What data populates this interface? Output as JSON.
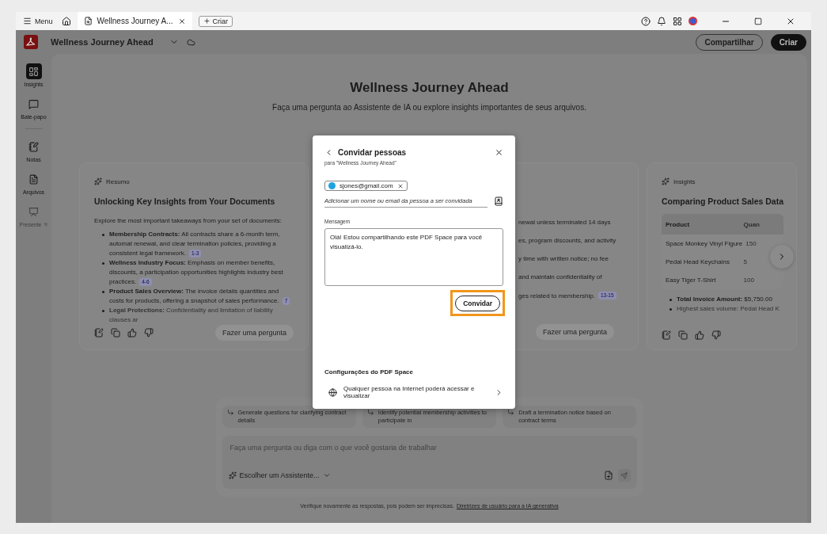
{
  "titlebar": {
    "menu": "Menu",
    "tab": {
      "label": "Wellness Journey A...",
      "selected": true
    },
    "new_button": "Criar"
  },
  "header": {
    "title": "Wellness Journey Ahead",
    "share": "Compartilhar",
    "create": "Criar"
  },
  "sidebar": {
    "groups": [
      [
        {
          "label": "Insights",
          "kind": "insights",
          "selected": true,
          "disabled": false
        },
        {
          "label": "Bate-papo",
          "kind": "chat",
          "selected": false,
          "disabled": false
        }
      ],
      [
        {
          "label": "Notas",
          "kind": "notes",
          "selected": false,
          "disabled": false
        },
        {
          "label": "Arquivos",
          "kind": "files",
          "selected": false,
          "disabled": false
        },
        {
          "label": "Presente",
          "kind": "present",
          "selected": false,
          "disabled": true
        }
      ]
    ]
  },
  "page": {
    "title": "Wellness Journey Ahead",
    "subtitle": "Faça uma pergunta ao Assistente de IA ou explore insights importantes de seus arquivos."
  },
  "cards": [
    {
      "kind": "summary",
      "tag": "Resumo",
      "title": "Unlocking Key Insights from Your Documents",
      "intro": "Explore the most important takeaways from your set of documents:",
      "bullets": [
        {
          "text": "**Membership Contracts:** All contracts share a 6-month term, automat renewal, and clear termination policies, providing a consistent legal framework.",
          "ref": "1-3"
        },
        {
          "text": "**Wellness Industry Focus:** Emphasis on member benefits, discounts, a participation opportunities highlights industry best practices.",
          "ref": "4-6"
        },
        {
          "text": "**Product Sales Overview:** The invoice details quantities and costs for products, offering a snapshot of sales performance.",
          "ref": "7"
        },
        {
          "text": "**Legal Protections:** Confidentiality and limitation of liability clauses ar"
        }
      ],
      "button": "Fazer uma pergunta"
    },
    {
      "kind": "fragment",
      "lines": [
        {
          "text": "newal unless terminated 14 days"
        },
        {
          "text": "es, program discounts, and activity"
        },
        {
          "text": "y time with written notice; no fee"
        },
        {
          "text": "and maintain confidentiality of"
        },
        {
          "text": "ges related to membership.",
          "ref": "13-15"
        }
      ],
      "button": "Fazer uma pergunta"
    },
    {
      "kind": "table",
      "tag": "Insights",
      "title": "Comparing Product Sales Data",
      "columns": [
        "Product",
        "Quan"
      ],
      "rows": [
        [
          "Space Monkey Vinyl Figure",
          "150"
        ],
        [
          "Pedal Head Keychains",
          "5"
        ],
        [
          "Easy Tiger T-Shirt",
          "100"
        ]
      ],
      "bullets": [
        {
          "text": "**Total Invoice Amount:** $5,750.00"
        },
        {
          "text": "Highest sales volume: Pedal Head K"
        }
      ]
    }
  ],
  "prompt": {
    "suggestions": [
      "Generate questions for clarifying contract details",
      "Identify potential membership activities to participate in",
      "Draft a termination notice based on contract terms"
    ],
    "placeholder": "Faça uma pergunta ou diga com o que você gostaria de trabalhar",
    "assistant": "Escolher um Assistente..."
  },
  "footer": {
    "note": "Verifique novamente as respostas, pois podem ser imprecisas.",
    "link": "Diretrizes de usuário para a IA generativa"
  },
  "dialog": {
    "title": "Convidar pessoas",
    "subtitle": "para \"Wellness Journey Ahead\"",
    "recipients": [
      {
        "email": "sjones@gmail.com",
        "color": "#1fa3e0"
      }
    ],
    "placeholder": "Adicionar um nome ou email da pessoa a ser convidada",
    "message_label": "Mensagem",
    "message": "Olá! Estou compartilhando este PDF Space para você visualizá-lo.",
    "invite": {
      "label": "Convidar",
      "highlighted": true
    },
    "settings_title": "Configurações do PDF Space",
    "access": "Qualquer pessoa na Internet poderá acessar e visualizar"
  }
}
